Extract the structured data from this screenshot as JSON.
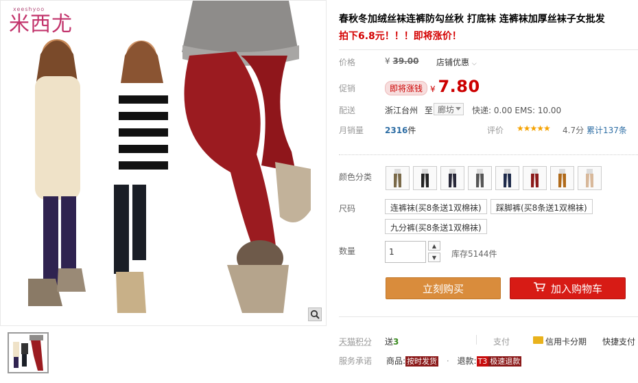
{
  "brand": {
    "name": "米西尤",
    "sub": "xeeshyoo"
  },
  "product": {
    "title": "春秋冬加绒丝袜连裤防勾丝秋 打底袜 连裤袜加厚丝袜子女批发",
    "subtitle": "拍下6.8元！！！即将涨价！"
  },
  "price": {
    "label": "价格",
    "currency": "¥",
    "original": "39.00",
    "shop_discount": "店铺优惠",
    "promo_label": "促销",
    "promo_tag": "即将涨钱",
    "promo_price": "7.80"
  },
  "shipping": {
    "label": "配送",
    "from": "浙江台州",
    "to_word": "至",
    "destination": "廊坊",
    "cost": "快递: 0.00 EMS: 10.00"
  },
  "sales": {
    "label": "月销量",
    "count": "2316",
    "unit": "件",
    "rating_label": "评价",
    "stars": "★★★★★",
    "rating": "4.7分",
    "reviews": "累计137条"
  },
  "color": {
    "label": "颜色分类",
    "swatches": [
      {
        "name": "swatch-1",
        "color": "#7a6a4a"
      },
      {
        "name": "swatch-2",
        "color": "#222222"
      },
      {
        "name": "swatch-3",
        "color": "#2a2a3a"
      },
      {
        "name": "swatch-4",
        "color": "#555555"
      },
      {
        "name": "swatch-5",
        "color": "#1e2a4a"
      },
      {
        "name": "swatch-6",
        "color": "#8b1a1a"
      },
      {
        "name": "swatch-7",
        "color": "#b06a1a"
      },
      {
        "name": "swatch-8",
        "color": "#d8b89a"
      }
    ]
  },
  "size": {
    "label": "尺码",
    "options": [
      "连裤袜(买8条送1双棉袜)",
      "踩脚裤(买8条送1双棉袜)",
      "九分裤(买8条送1双棉袜)"
    ]
  },
  "quantity": {
    "label": "数量",
    "value": "1",
    "up": "▲",
    "down": "▼",
    "stock": "库存5144件"
  },
  "buttons": {
    "buy_now": "立刻购买",
    "add_to_cart": "加入购物车",
    "cart_icon": "🛒"
  },
  "points": {
    "label": "天猫积分",
    "prefix": "送",
    "value": "3"
  },
  "payment": {
    "label": "支付",
    "credit": "信用卡分期",
    "quick": "快捷支付"
  },
  "service": {
    "label": "服务承诺",
    "goods_prefix": "商品:",
    "goods_badge": "按时发货",
    "sep": "·",
    "refund_prefix": "退款:",
    "refund_code": "T3",
    "refund_badge": "极速退款"
  },
  "icons": {
    "zoom": "magnifier-icon"
  }
}
